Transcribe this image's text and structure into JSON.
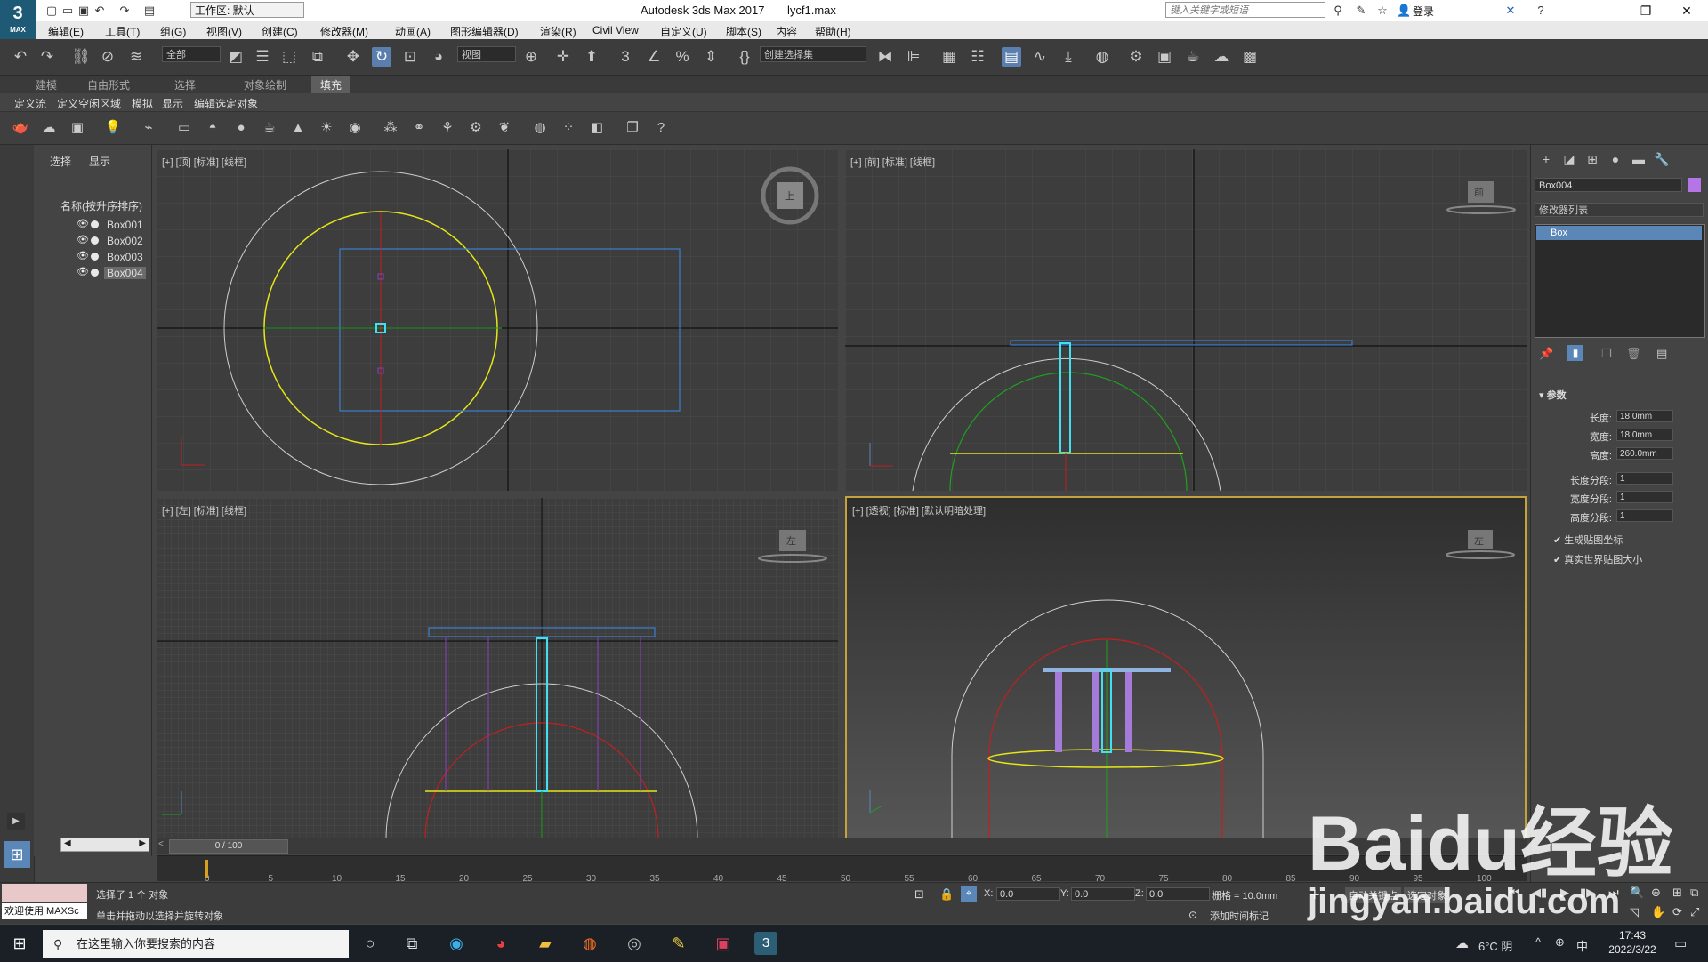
{
  "window": {
    "app_title": "Autodesk 3ds Max 2017",
    "file_name": "lycf1.max",
    "logo": "3",
    "logo_sub": "MAX",
    "workspace": "工作区: 默认",
    "search_placeholder": "键入关键字或短语",
    "login": "登录"
  },
  "menu": [
    "编辑(E)",
    "工具(T)",
    "组(G)",
    "视图(V)",
    "创建(C)",
    "修改器(M)",
    "动画(A)",
    "图形编辑器(D)",
    "渲染(R)",
    "Civil View",
    "自定义(U)",
    "脚本(S)",
    "内容",
    "帮助(H)"
  ],
  "toolbar": {
    "filter_dropdown": "全部",
    "coord_dropdown": "视图",
    "selection_set": "创建选择集"
  },
  "ribbon": {
    "tabs": [
      "建模",
      "自由形式",
      "选择",
      "对象绘制",
      "填充"
    ],
    "active_tab": "填充",
    "subitems": [
      "定义流",
      "定义空闲区域",
      "模拟",
      "显示",
      "编辑选定对象"
    ]
  },
  "scene_explorer": {
    "tabs": [
      "选择",
      "显示"
    ],
    "header": "名称(按升序排序)",
    "objects": [
      "Box001",
      "Box002",
      "Box003",
      "Box004"
    ],
    "selected": "Box004"
  },
  "viewports": [
    {
      "label": "[+] [顶] [标准] [线框]"
    },
    {
      "label": "[+] [前] [标准] [线框]"
    },
    {
      "label": "[+] [左] [标准] [线框]"
    },
    {
      "label": "[+] [透视] [标准] [默认明暗处理]"
    }
  ],
  "viewcube_faces": {
    "top": "上",
    "front": "前",
    "left": "左",
    "persp": "左"
  },
  "timeline": {
    "position": "0 / 100",
    "ticks": [
      "0",
      "5",
      "10",
      "15",
      "20",
      "25",
      "30",
      "35",
      "40",
      "45",
      "50",
      "55",
      "60",
      "65",
      "70",
      "75",
      "80",
      "85",
      "90",
      "95",
      "100"
    ]
  },
  "command_panel": {
    "object_name": "Box004",
    "object_color": "#b675e6",
    "modifier_list": "修改器列表",
    "stack_item": "Box",
    "rollout_title": "参数",
    "params": [
      {
        "label": "长度:",
        "value": "18.0mm"
      },
      {
        "label": "宽度:",
        "value": "18.0mm"
      },
      {
        "label": "高度:",
        "value": "260.0mm"
      },
      {
        "label": "长度分段:",
        "value": "1"
      },
      {
        "label": "宽度分段:",
        "value": "1"
      },
      {
        "label": "高度分段:",
        "value": "1"
      }
    ],
    "checkboxes": [
      "生成贴图坐标",
      "真实世界贴图大小"
    ]
  },
  "status": {
    "welcome": "欢迎使用 MAXSc",
    "selected_count": "选择了 1 个 对象",
    "hint": "单击并拖动以选择并旋转对象",
    "x_label": "X:",
    "x_value": "0.0",
    "y_label": "Y:",
    "y_value": "0.0",
    "z_label": "Z:",
    "z_value": "0.0",
    "grid": "栅格 = 10.0mm",
    "add_tag": "添加时间标记",
    "auto_key": "自动关键点",
    "set_key": "选定对象"
  },
  "taskbar": {
    "search_placeholder": "在这里输入你要搜索的内容",
    "weather": "6°C 阴",
    "ime": "中",
    "time": "17:43",
    "date": "2022/3/22"
  },
  "watermark": {
    "text": "Baidu经验",
    "url": "jingyan.baidu.com"
  },
  "colors": {
    "accent": "#5a86b8",
    "viewport_bg": "#3d3d3d",
    "active_border": "#c5a33a"
  }
}
